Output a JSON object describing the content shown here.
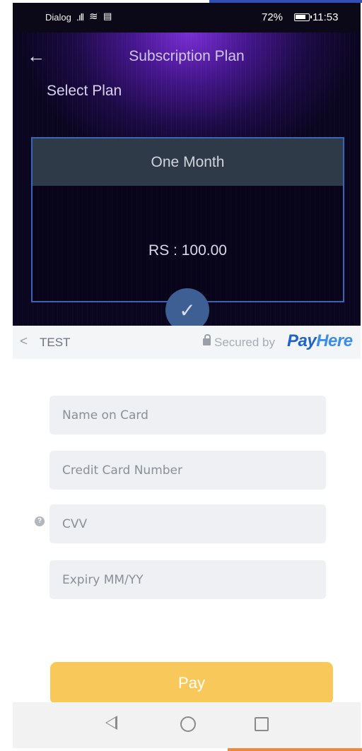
{
  "status_bar": {
    "carrier": "Dialog",
    "signal_icon": "signal-icon",
    "wifi_icon": "wifi-icon",
    "data_icon": "data-saver-icon",
    "battery": "72%",
    "time": "11:53"
  },
  "app": {
    "title": "Subscription Plan",
    "section_label": "Select Plan",
    "plan": {
      "name": "One Month",
      "price": "RS : 100.00",
      "selected": true
    }
  },
  "payment": {
    "header_label": "TEST",
    "secured_text": "Secured by",
    "brand_part1": "Pay",
    "brand_part2": "Here",
    "fields": {
      "name_placeholder": "Name on Card",
      "card_placeholder": "Credit Card Number",
      "cvv_placeholder": "CVV",
      "expiry_placeholder": "Expiry MM/YY"
    },
    "pay_label": "Pay"
  },
  "colors": {
    "accent_top": "#2f4fb4",
    "plan_border": "#3a64b8",
    "pay_button": "#f9c85a",
    "brand_blue": "#1f62c9",
    "accent_bottom": "#ef8a3a"
  }
}
